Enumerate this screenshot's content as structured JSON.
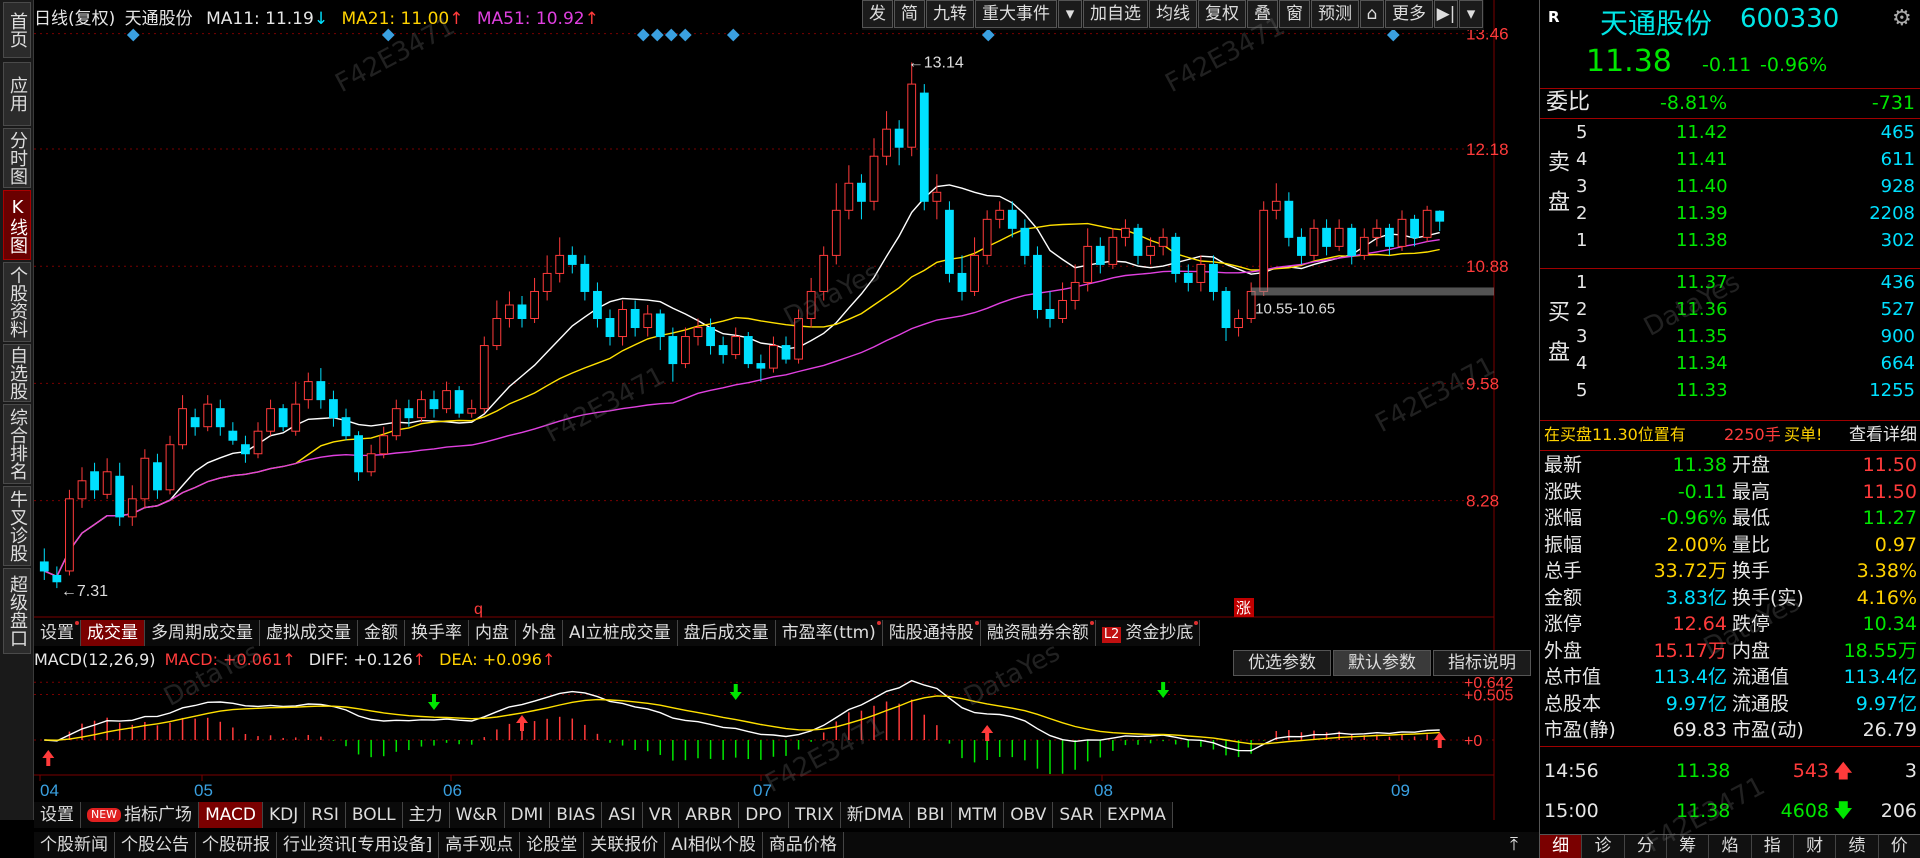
{
  "lnav": [
    {
      "label": "首页"
    },
    {
      "label": "应用"
    },
    {
      "label": "分时图"
    },
    {
      "label": "K线图",
      "active": true
    },
    {
      "label": "个股资料"
    },
    {
      "label": "自选股"
    },
    {
      "label": "综合排名"
    },
    {
      "label": "牛叉诊股"
    },
    {
      "label": "超级盘口"
    }
  ],
  "header": {
    "title": "日线(复权)",
    "stock": "天通股份",
    "ma11": "MA11: 11.19",
    "ma11_arrow": "↓",
    "ma21": "MA21: 11.00",
    "ma21_arrow": "↑",
    "ma51": "MA51: 10.92",
    "ma51_arrow": "↑"
  },
  "toolbar": [
    "发",
    "简",
    "九转",
    "重大事件",
    "▾",
    "加自选",
    "均线",
    "复权",
    "叠",
    "窗",
    "预测",
    "⌂",
    "更多",
    "▶|",
    "▾"
  ],
  "chart_data": {
    "type": "candlestick",
    "y_ticks": [
      "13.46",
      "12.18",
      "10.88",
      "9.58",
      "8.28"
    ],
    "ylim": [
      7.2,
      13.5
    ],
    "x_ticks": [
      "04",
      "05",
      "06",
      "07",
      "08",
      "09"
    ],
    "high_label": "13.14",
    "low_label": "7.31",
    "zone_label": "10.55-10.65",
    "markers": [
      "q",
      "涨"
    ],
    "candles": [
      [
        7.6,
        7.5,
        7.75,
        7.4
      ],
      [
        7.45,
        7.38,
        7.55,
        7.31
      ],
      [
        7.5,
        8.3,
        8.4,
        7.45
      ],
      [
        8.3,
        8.5,
        8.65,
        8.2
      ],
      [
        8.6,
        8.4,
        8.7,
        8.3
      ],
      [
        8.35,
        8.6,
        8.75,
        8.3
      ],
      [
        8.55,
        8.1,
        8.7,
        8.0
      ],
      [
        8.1,
        8.3,
        8.45,
        8.0
      ],
      [
        8.3,
        8.75,
        8.85,
        8.2
      ],
      [
        8.7,
        8.4,
        8.8,
        8.3
      ],
      [
        8.4,
        8.9,
        9.0,
        8.35
      ],
      [
        8.9,
        9.3,
        9.45,
        8.85
      ],
      [
        9.2,
        9.1,
        9.3,
        9.0
      ],
      [
        9.1,
        9.35,
        9.45,
        9.05
      ],
      [
        9.3,
        9.1,
        9.4,
        9.0
      ],
      [
        9.05,
        8.95,
        9.15,
        8.9
      ],
      [
        8.9,
        8.8,
        9.0,
        8.7
      ],
      [
        8.8,
        9.05,
        9.15,
        8.75
      ],
      [
        9.05,
        9.3,
        9.4,
        9.0
      ],
      [
        9.3,
        9.1,
        9.35,
        9.05
      ],
      [
        9.05,
        9.35,
        9.6,
        9.0
      ],
      [
        9.4,
        9.6,
        9.7,
        9.3
      ],
      [
        9.6,
        9.4,
        9.75,
        9.3
      ],
      [
        9.4,
        9.2,
        9.5,
        9.1
      ],
      [
        9.2,
        9.0,
        9.3,
        8.95
      ],
      [
        9.0,
        8.6,
        9.05,
        8.5
      ],
      [
        8.6,
        8.8,
        8.9,
        8.55
      ],
      [
        8.8,
        9.0,
        9.1,
        8.75
      ],
      [
        9.0,
        9.3,
        9.4,
        8.95
      ],
      [
        9.3,
        9.2,
        9.4,
        9.1
      ],
      [
        9.2,
        9.4,
        9.5,
        9.15
      ],
      [
        9.4,
        9.3,
        9.5,
        9.2
      ],
      [
        9.3,
        9.5,
        9.6,
        9.25
      ],
      [
        9.5,
        9.25,
        9.55,
        9.2
      ],
      [
        9.25,
        9.3,
        9.4,
        9.2
      ],
      [
        9.3,
        10.0,
        10.1,
        9.25
      ],
      [
        10.0,
        10.3,
        10.5,
        9.95
      ],
      [
        10.3,
        10.45,
        10.6,
        10.2
      ],
      [
        10.45,
        10.3,
        10.55,
        10.2
      ],
      [
        10.3,
        10.6,
        10.75,
        10.25
      ],
      [
        10.6,
        10.8,
        11.0,
        10.5
      ],
      [
        10.8,
        11.0,
        11.2,
        10.7
      ],
      [
        11.0,
        10.9,
        11.1,
        10.8
      ],
      [
        10.9,
        10.6,
        11.0,
        10.5
      ],
      [
        10.6,
        10.3,
        10.7,
        10.2
      ],
      [
        10.3,
        10.1,
        10.4,
        10.0
      ],
      [
        10.1,
        10.4,
        10.5,
        10.0
      ],
      [
        10.4,
        10.2,
        10.5,
        10.1
      ],
      [
        10.2,
        10.35,
        10.45,
        10.1
      ],
      [
        10.35,
        10.1,
        10.4,
        9.95
      ],
      [
        10.1,
        9.8,
        10.2,
        9.6
      ],
      [
        9.8,
        10.1,
        10.2,
        9.75
      ],
      [
        10.1,
        10.2,
        10.3,
        10.0
      ],
      [
        10.2,
        10.0,
        10.3,
        9.9
      ],
      [
        10.0,
        9.9,
        10.1,
        9.8
      ],
      [
        9.9,
        10.1,
        10.2,
        9.85
      ],
      [
        10.1,
        9.8,
        10.15,
        9.75
      ],
      [
        9.8,
        9.75,
        9.9,
        9.6
      ],
      [
        9.75,
        10.0,
        10.1,
        9.7
      ],
      [
        10.0,
        9.85,
        10.1,
        9.8
      ],
      [
        9.85,
        10.3,
        10.4,
        9.8
      ],
      [
        10.3,
        10.6,
        10.75,
        10.2
      ],
      [
        10.6,
        11.0,
        11.1,
        10.5
      ],
      [
        11.0,
        11.5,
        11.8,
        10.9
      ],
      [
        11.5,
        11.8,
        12.0,
        11.4
      ],
      [
        11.8,
        11.6,
        11.9,
        11.4
      ],
      [
        11.6,
        12.1,
        12.3,
        11.5
      ],
      [
        12.1,
        12.4,
        12.6,
        12.0
      ],
      [
        12.4,
        12.2,
        12.5,
        12.0
      ],
      [
        12.2,
        12.9,
        13.14,
        12.1
      ],
      [
        12.8,
        11.6,
        12.9,
        11.5
      ],
      [
        11.6,
        11.7,
        11.9,
        11.4
      ],
      [
        11.5,
        10.8,
        11.6,
        10.7
      ],
      [
        10.8,
        10.6,
        11.0,
        10.5
      ],
      [
        10.6,
        11.0,
        11.2,
        10.55
      ],
      [
        11.0,
        11.4,
        11.5,
        10.9
      ],
      [
        11.4,
        11.5,
        11.6,
        11.3
      ],
      [
        11.5,
        11.3,
        11.6,
        11.2
      ],
      [
        11.3,
        11.0,
        11.4,
        10.9
      ],
      [
        11.0,
        10.4,
        11.1,
        10.3
      ],
      [
        10.4,
        10.3,
        10.6,
        10.2
      ],
      [
        10.3,
        10.5,
        10.7,
        10.25
      ],
      [
        10.5,
        10.7,
        10.9,
        10.4
      ],
      [
        10.7,
        11.1,
        11.3,
        10.6
      ],
      [
        11.1,
        10.9,
        11.2,
        10.8
      ],
      [
        10.9,
        11.2,
        11.3,
        10.85
      ],
      [
        11.2,
        11.3,
        11.4,
        11.1
      ],
      [
        11.3,
        11.0,
        11.35,
        10.9
      ],
      [
        11.0,
        11.1,
        11.2,
        10.9
      ],
      [
        11.1,
        11.2,
        11.3,
        11.0
      ],
      [
        11.2,
        10.8,
        11.25,
        10.7
      ],
      [
        10.8,
        10.7,
        10.9,
        10.6
      ],
      [
        10.7,
        10.9,
        11.0,
        10.6
      ],
      [
        10.9,
        10.6,
        11.0,
        10.5
      ],
      [
        10.6,
        10.2,
        10.65,
        10.05
      ],
      [
        10.2,
        10.3,
        10.4,
        10.1
      ],
      [
        10.3,
        10.6,
        10.7,
        10.25
      ],
      [
        10.6,
        11.5,
        11.6,
        10.55
      ],
      [
        11.5,
        11.6,
        11.8,
        11.4
      ],
      [
        11.6,
        11.2,
        11.7,
        11.1
      ],
      [
        11.2,
        11.0,
        11.3,
        10.9
      ],
      [
        11.0,
        11.3,
        11.4,
        10.95
      ],
      [
        11.3,
        11.1,
        11.4,
        11.0
      ],
      [
        11.1,
        11.3,
        11.4,
        11.05
      ],
      [
        11.3,
        11.0,
        11.35,
        10.9
      ],
      [
        11.0,
        11.2,
        11.3,
        10.95
      ],
      [
        11.2,
        11.3,
        11.4,
        11.1
      ],
      [
        11.3,
        11.1,
        11.35,
        11.0
      ],
      [
        11.1,
        11.4,
        11.5,
        11.05
      ],
      [
        11.4,
        11.2,
        11.45,
        11.1
      ],
      [
        11.2,
        11.5,
        11.55,
        11.15
      ],
      [
        11.49,
        11.38,
        11.5,
        11.27
      ]
    ]
  },
  "vol_tabs": [
    {
      "label": "设置",
      "dot": true
    },
    {
      "label": "成交量",
      "active": true
    },
    {
      "label": "多周期成交量"
    },
    {
      "label": "虚拟成交量"
    },
    {
      "label": "金额"
    },
    {
      "label": "换手率"
    },
    {
      "label": "内盘"
    },
    {
      "label": "外盘"
    },
    {
      "label": "AI立桩成交量"
    },
    {
      "label": "盘后成交量"
    },
    {
      "label": "市盈率(ttm)",
      "dot": true
    },
    {
      "label": "陆股通持股",
      "dot": true
    },
    {
      "label": "融资融券余额",
      "dot": true
    },
    {
      "label": "资金抄底",
      "l2": "L2",
      "dot": true
    }
  ],
  "macd": {
    "title": "MACD(12,26,9)",
    "macd": "MACD: +0.061",
    "macd_arrow": "↑",
    "diff": "DIFF: +0.126",
    "diff_arrow": "↑",
    "dea": "DEA: +0.096",
    "dea_arrow": "↑",
    "ticks": [
      "+0.642",
      "+0.505",
      "+0"
    ],
    "params": [
      {
        "label": "优选参数"
      },
      {
        "label": "默认参数",
        "active": true
      },
      {
        "label": "指标说明"
      }
    ]
  },
  "ind_tabs": [
    {
      "label": "设置"
    },
    {
      "label": "指标广场",
      "badge": "NEW"
    },
    {
      "label": "MACD",
      "active": true
    },
    {
      "label": "KDJ"
    },
    {
      "label": "RSI"
    },
    {
      "label": "BOLL"
    },
    {
      "label": "主力"
    },
    {
      "label": "W&R"
    },
    {
      "label": "DMI"
    },
    {
      "label": "BIAS"
    },
    {
      "label": "ASI"
    },
    {
      "label": "VR"
    },
    {
      "label": "ARBR"
    },
    {
      "label": "DPO"
    },
    {
      "label": "TRIX"
    },
    {
      "label": "新DMA"
    },
    {
      "label": "BBI"
    },
    {
      "label": "MTM"
    },
    {
      "label": "OBV"
    },
    {
      "label": "SAR"
    },
    {
      "label": "EXPMA"
    }
  ],
  "news_tabs": [
    {
      "label": "个股新闻"
    },
    {
      "label": "个股公告"
    },
    {
      "label": "个股研报"
    },
    {
      "label": "行业资讯[专用设备]"
    },
    {
      "label": "高手观点"
    },
    {
      "label": "论股堂"
    },
    {
      "label": "关联报价"
    },
    {
      "label": "AI相似个股"
    },
    {
      "label": "商品价格"
    }
  ],
  "quote": {
    "badge": "R",
    "name": "天通股份",
    "code": "600330",
    "price": "11.38",
    "change": "-0.11",
    "pct": "-0.96%",
    "weibi_label": "委比",
    "weibi_pct": "-8.81%",
    "weibi_diff": "-731",
    "sell_label": "卖盘",
    "buy_label": "买盘",
    "asks": [
      {
        "lvl": "5",
        "price": "11.42",
        "vol": "465"
      },
      {
        "lvl": "4",
        "price": "11.41",
        "vol": "611"
      },
      {
        "lvl": "3",
        "price": "11.40",
        "vol": "928"
      },
      {
        "lvl": "2",
        "price": "11.39",
        "vol": "2208"
      },
      {
        "lvl": "1",
        "price": "11.38",
        "vol": "302"
      }
    ],
    "bids": [
      {
        "lvl": "1",
        "price": "11.37",
        "vol": "436"
      },
      {
        "lvl": "2",
        "price": "11.36",
        "vol": "527"
      },
      {
        "lvl": "3",
        "price": "11.35",
        "vol": "900"
      },
      {
        "lvl": "4",
        "price": "11.34",
        "vol": "664"
      },
      {
        "lvl": "5",
        "price": "11.33",
        "vol": "1255"
      }
    ],
    "notice_a": "在买盘11.30位置有",
    "notice_b": "2250手",
    "notice_c": "买单!",
    "notice_link": "查看详细",
    "stats": [
      {
        "l1": "最新",
        "v1": "11.38",
        "c1": "grn",
        "l2": "开盘",
        "v2": "11.50",
        "c2": "red"
      },
      {
        "l1": "涨跌",
        "v1": "-0.11",
        "c1": "grn",
        "l2": "最高",
        "v2": "11.50",
        "c2": "red"
      },
      {
        "l1": "涨幅",
        "v1": "-0.96%",
        "c1": "grn",
        "l2": "最低",
        "v2": "11.27",
        "c2": "grn"
      },
      {
        "l1": "振幅",
        "v1": "2.00%",
        "c1": "yel",
        "l2": "量比",
        "v2": "0.97",
        "c2": "yel"
      },
      {
        "l1": "总手",
        "v1": "33.72万",
        "c1": "yel",
        "l2": "换手",
        "v2": "3.38%",
        "c2": "yel"
      },
      {
        "l1": "金额",
        "v1": "3.83亿",
        "c1": "cyn",
        "l2": "换手(实)",
        "v2": "4.16%",
        "c2": "yel"
      },
      {
        "l1": "涨停",
        "v1": "12.64",
        "c1": "red",
        "l2": "跌停",
        "v2": "10.34",
        "c2": "grn"
      },
      {
        "l1": "外盘",
        "v1": "15.17万",
        "c1": "red",
        "l2": "内盘",
        "v2": "18.55万",
        "c2": "grn"
      },
      {
        "l1": "总市值",
        "v1": "113.4亿",
        "c1": "cyn",
        "l2": "流通值",
        "v2": "113.4亿",
        "c2": "cyn"
      },
      {
        "l1": "总股本",
        "v1": "9.97亿",
        "c1": "cyn",
        "l2": "流通股",
        "v2": "9.97亿",
        "c2": "cyn"
      },
      {
        "l1": "市盈(静)",
        "v1": "69.83",
        "c1": "wht",
        "l2": "市盈(动)",
        "v2": "26.79",
        "c2": "wht"
      }
    ],
    "ticks": [
      {
        "time": "14:56",
        "price": "11.38",
        "vol": "543",
        "dir": "up",
        "n": "3"
      },
      {
        "time": "15:00",
        "price": "11.38",
        "vol": "4608",
        "dir": "down",
        "n": "206"
      }
    ],
    "bottom_tabs": [
      {
        "label": "细",
        "active": true
      },
      {
        "label": "诊"
      },
      {
        "label": "分"
      },
      {
        "label": "筹"
      },
      {
        "label": "焰"
      },
      {
        "label": "指"
      },
      {
        "label": "财"
      },
      {
        "label": "绩"
      },
      {
        "label": "价"
      }
    ]
  },
  "watermarks": [
    "F42E3471",
    "DataYes"
  ],
  "colors": {
    "up": "#ff3b3b",
    "down": "#00e0ff",
    "ma11": "#ffffff",
    "ma21": "#ffe000",
    "ma51": "#e040e0",
    "grid": "#7a0000"
  }
}
